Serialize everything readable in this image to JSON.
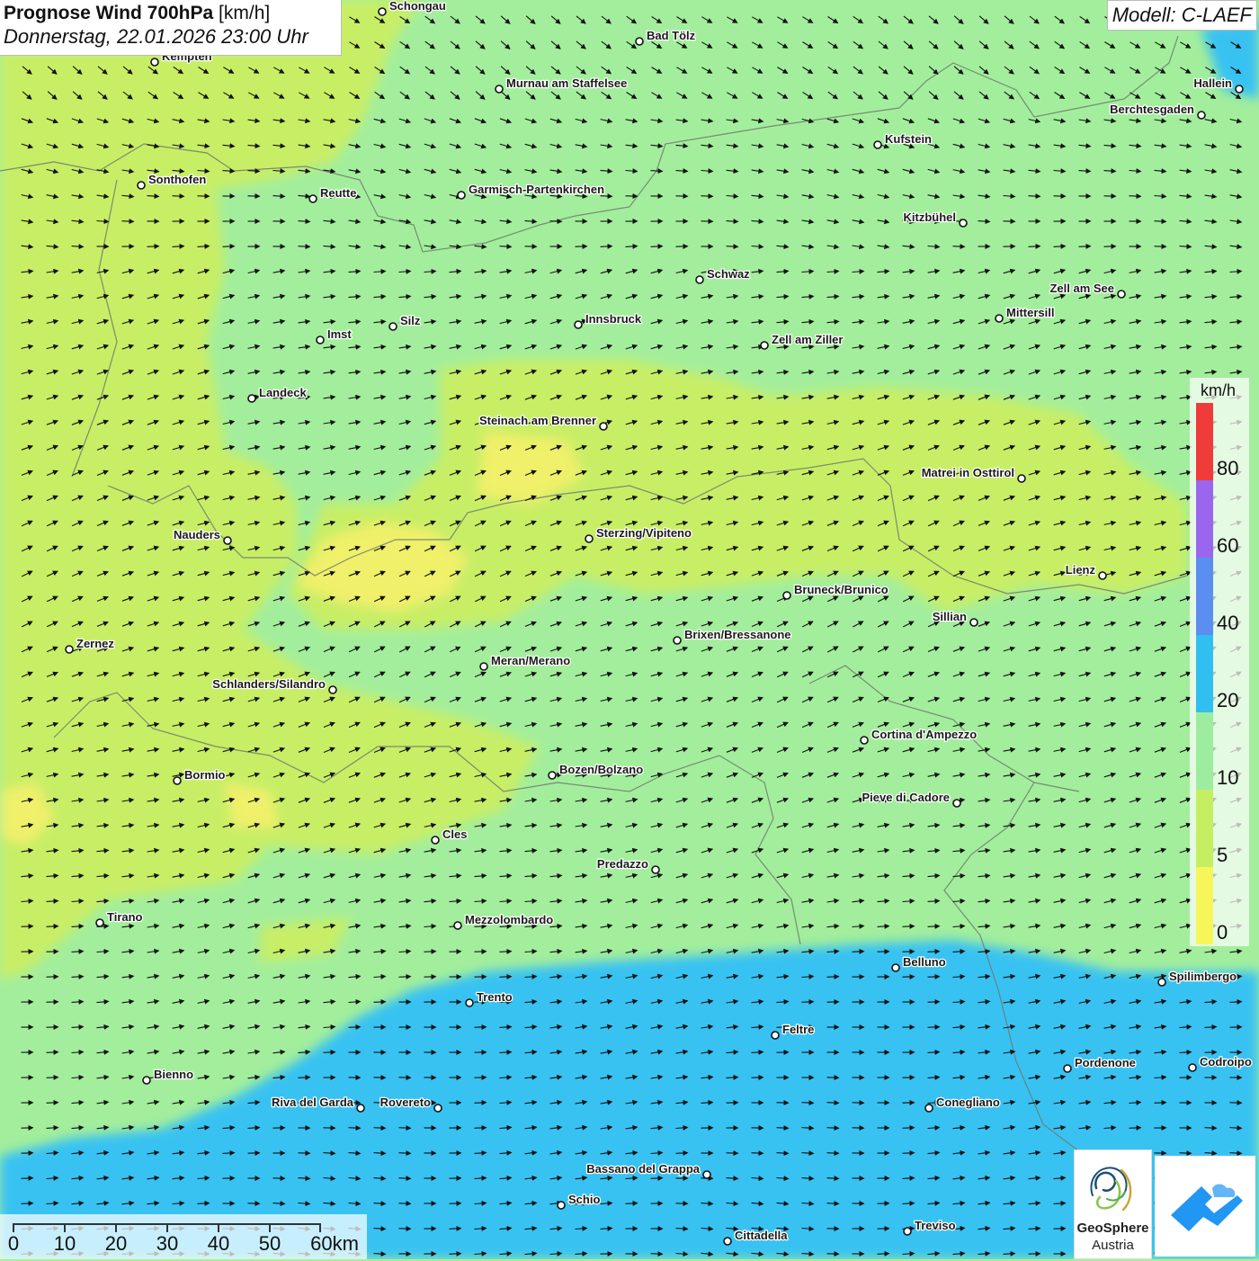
{
  "header": {
    "title_bold": "Prognose Wind 700hPa",
    "title_unit": "[km/h]",
    "datetime": "Donnerstag, 22.01.2026 23:00 Uhr",
    "model": "Modell: C-LAEF"
  },
  "legend": {
    "unit": "km/h",
    "labels": [
      "80",
      "60",
      "40",
      "20",
      "10",
      "5",
      "0"
    ],
    "colors": {
      "0-5": "#f6f65a",
      "5-10": "#c6ee62",
      "10-20": "#9ceda0",
      "20-40": "#30bff0",
      "40-60": "#5a8ef0",
      "60-80": "#9a66ee",
      "80+": "#f03b3b"
    }
  },
  "scale_bar": {
    "labels": [
      "0",
      "10",
      "20",
      "30",
      "40",
      "50",
      "60km"
    ]
  },
  "logo": {
    "name": "GeoSphere",
    "sub": "Austria"
  },
  "icons": [
    "geosphere-logo-icon",
    "warn-app-icon"
  ],
  "cities": [
    {
      "name": "Schongau"
    },
    {
      "name": "Bad Tölz"
    },
    {
      "name": "Kempten"
    },
    {
      "name": "Murnau am Staffelsee"
    },
    {
      "name": "Hallein"
    },
    {
      "name": "Berchtesgaden"
    },
    {
      "name": "Kufstein"
    },
    {
      "name": "Sonthofen"
    },
    {
      "name": "Reutte"
    },
    {
      "name": "Garmisch-Partenkirchen"
    },
    {
      "name": "Kitzbühel"
    },
    {
      "name": "Schwaz"
    },
    {
      "name": "Zell am See"
    },
    {
      "name": "Mittersill"
    },
    {
      "name": "Innsbruck"
    },
    {
      "name": "Silz"
    },
    {
      "name": "Imst"
    },
    {
      "name": "Zell am Ziller"
    },
    {
      "name": "Landeck"
    },
    {
      "name": "Steinach am Brenner"
    },
    {
      "name": "Matrei in Osttirol"
    },
    {
      "name": "Nauders"
    },
    {
      "name": "Sterzing/Vipiteno"
    },
    {
      "name": "Lienz"
    },
    {
      "name": "Bruneck/Brunico"
    },
    {
      "name": "Sillian"
    },
    {
      "name": "Brixen/Bressanone"
    },
    {
      "name": "Zernez"
    },
    {
      "name": "Meran/Merano"
    },
    {
      "name": "Schlanders/Silandro"
    },
    {
      "name": "Cortina d'Ampezzo"
    },
    {
      "name": "Bozen/Bolzano"
    },
    {
      "name": "Bormio"
    },
    {
      "name": "Pieve di Cadore"
    },
    {
      "name": "Cles"
    },
    {
      "name": "Predazzo"
    },
    {
      "name": "Tirano"
    },
    {
      "name": "Mezzolombardo"
    },
    {
      "name": "Belluno"
    },
    {
      "name": "Spilimbergo"
    },
    {
      "name": "Trento"
    },
    {
      "name": "Feltre"
    },
    {
      "name": "Pordenone"
    },
    {
      "name": "Codroipo"
    },
    {
      "name": "Bienno"
    },
    {
      "name": "Riva del Garda"
    },
    {
      "name": "Rovereto"
    },
    {
      "name": "Conegliano"
    },
    {
      "name": "Bassano del Grappa"
    },
    {
      "name": "Schio"
    },
    {
      "name": "Treviso"
    },
    {
      "name": "Cittadella"
    }
  ]
}
